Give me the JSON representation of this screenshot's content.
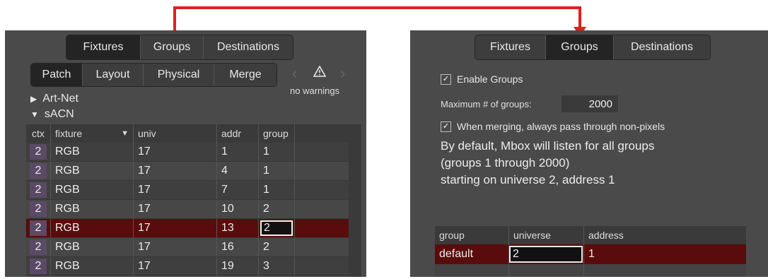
{
  "left": {
    "top_tabs": [
      "Fixtures",
      "Groups",
      "Destinations"
    ],
    "sub_tabs": [
      "Patch",
      "Layout",
      "Physical",
      "Merge"
    ],
    "warning_text": "no warnings",
    "tree": [
      {
        "label": "Art-Net",
        "expanded": false
      },
      {
        "label": "sACN",
        "expanded": true
      }
    ],
    "table": {
      "columns": [
        "ctx",
        "fixture",
        "univ",
        "addr",
        "group"
      ],
      "rows": [
        {
          "ctx": "2",
          "fixture": "RGB",
          "univ": "17",
          "addr": "1",
          "group": "1"
        },
        {
          "ctx": "2",
          "fixture": "RGB",
          "univ": "17",
          "addr": "4",
          "group": "1"
        },
        {
          "ctx": "2",
          "fixture": "RGB",
          "univ": "17",
          "addr": "7",
          "group": "1"
        },
        {
          "ctx": "2",
          "fixture": "RGB",
          "univ": "17",
          "addr": "10",
          "group": "2"
        },
        {
          "ctx": "2",
          "fixture": "RGB",
          "univ": "17",
          "addr": "13",
          "group": "2"
        },
        {
          "ctx": "2",
          "fixture": "RGB",
          "univ": "17",
          "addr": "16",
          "group": "2"
        },
        {
          "ctx": "2",
          "fixture": "RGB",
          "univ": "17",
          "addr": "19",
          "group": "3"
        }
      ]
    }
  },
  "right": {
    "top_tabs": [
      "Fixtures",
      "Groups",
      "Destinations"
    ],
    "enable_groups": "Enable Groups",
    "max_groups_label": "Maximum # of groups:",
    "max_groups_value": "2000",
    "pass_through": "When merging, always pass through non-pixels",
    "info_lines": [
      "By default, Mbox will listen for all groups",
      "(groups 1 through 2000)",
      "starting on universe 2, address 1"
    ],
    "table": {
      "columns": [
        "group",
        "universe",
        "address"
      ],
      "row": {
        "group": "default",
        "universe": "2",
        "address": "1"
      }
    }
  },
  "colors": {
    "panel_bg": "#4a4a4a",
    "selected_row": "#5a0c0c",
    "connector": "#e02020"
  }
}
